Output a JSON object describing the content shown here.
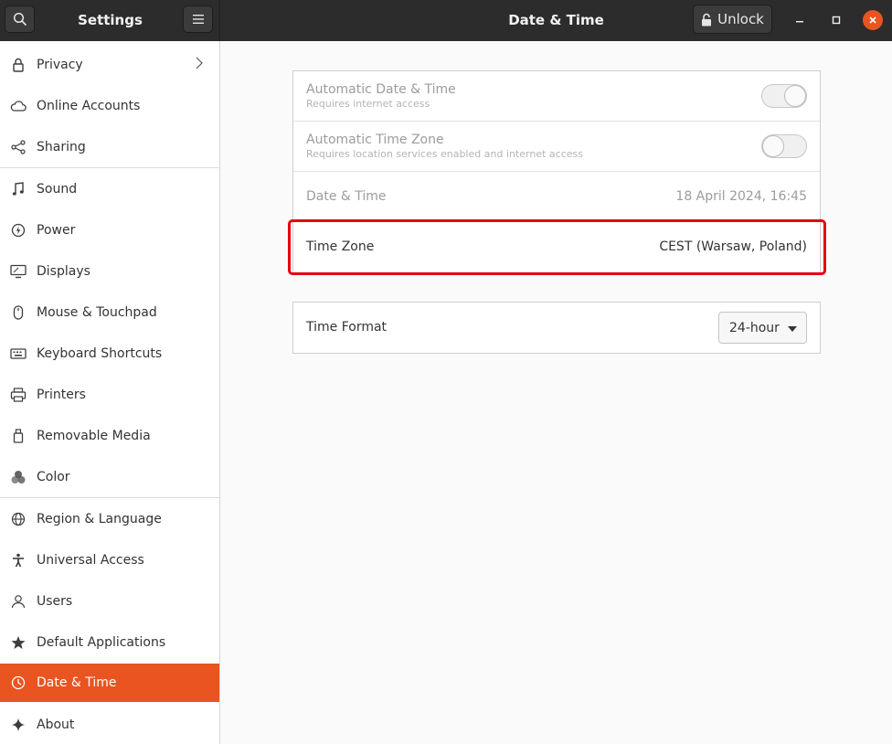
{
  "header": {
    "app_title": "Settings",
    "page_title": "Date & Time",
    "unlock_label": "Unlock",
    "search_icon": "search-icon",
    "menu_icon": "hamburger-menu-icon"
  },
  "sidebar": {
    "items": [
      {
        "label": "Privacy",
        "icon": "lock-icon"
      },
      {
        "label": "Online Accounts",
        "icon": "cloud-icon"
      },
      {
        "label": "Sharing",
        "icon": "share-icon"
      },
      {
        "label": "Sound",
        "icon": "music-note-icon"
      },
      {
        "label": "Power",
        "icon": "power-icon"
      },
      {
        "label": "Displays",
        "icon": "display-icon"
      },
      {
        "label": "Mouse & Touchpad",
        "icon": "mouse-icon"
      },
      {
        "label": "Keyboard Shortcuts",
        "icon": "keyboard-icon"
      },
      {
        "label": "Printers",
        "icon": "printer-icon"
      },
      {
        "label": "Removable Media",
        "icon": "usb-drive-icon"
      },
      {
        "label": "Color",
        "icon": "color-icon"
      },
      {
        "label": "Region & Language",
        "icon": "globe-icon"
      },
      {
        "label": "Universal Access",
        "icon": "accessibility-icon"
      },
      {
        "label": "Users",
        "icon": "users-icon"
      },
      {
        "label": "Default Applications",
        "icon": "star-icon"
      },
      {
        "label": "Date & Time",
        "icon": "clock-icon"
      },
      {
        "label": "About",
        "icon": "sparkle-icon"
      }
    ],
    "active_item": "Date & Time"
  },
  "datetime": {
    "auto_date_time": {
      "title": "Automatic Date & Time",
      "subtitle": "Requires internet access",
      "enabled": true
    },
    "auto_time_zone": {
      "title": "Automatic Time Zone",
      "subtitle": "Requires location services enabled and internet access",
      "enabled": false
    },
    "date_time": {
      "title": "Date & Time",
      "value": "18 April 2024, 16:45"
    },
    "time_zone": {
      "title": "Time Zone",
      "value": "CEST (Warsaw, Poland)"
    }
  },
  "time_format": {
    "title": "Time Format",
    "selected": "24-hour"
  },
  "colors": {
    "accent": "#e95420",
    "highlight_border": "#e4000f",
    "header_bg": "#2c2c2c"
  }
}
